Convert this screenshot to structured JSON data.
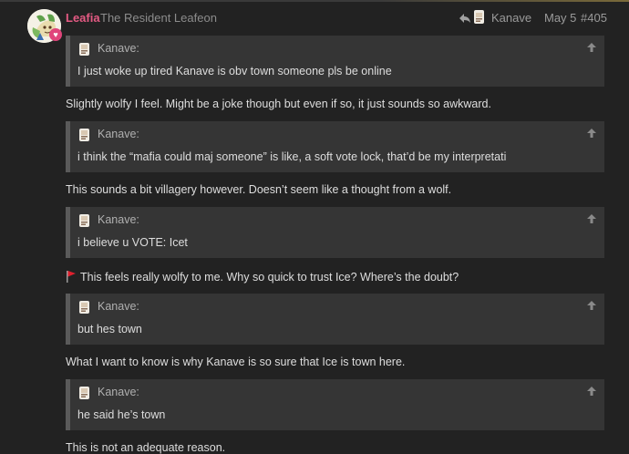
{
  "post": {
    "username": "Leafia",
    "user_title": "The Resident Leafeon",
    "reply_to": "Kanave",
    "date": "May 5",
    "post_number": "#405"
  },
  "blocks": [
    {
      "quote_author": "Kanave:",
      "quote_text": "I just woke up tired Kanave is obv town someone pls be online",
      "reply": "Slightly wolfy I feel. Might be a joke though but even if so, it just sounds so awkward."
    },
    {
      "quote_author": "Kanave:",
      "quote_text": "i think the “mafia could maj someone” is like, a soft vote lock, that’d be my interpretati",
      "reply": "This sounds a bit villagery however. Doesn’t seem like a thought from a wolf."
    },
    {
      "quote_author": "Kanave:",
      "quote_text": "i believe u VOTE: Icet",
      "reply": "This feels really wolfy to me. Why so quick to trust Ice? Where’s the doubt?"
    },
    {
      "quote_author": "Kanave:",
      "quote_text": "but hes town",
      "reply": "What I want to know is why Kanave is so sure that Ice is town here."
    },
    {
      "quote_author": "Kanave:",
      "quote_text": "he said he’s town",
      "reply": "This is not an adequate reason."
    }
  ],
  "icons": {
    "reply": "reply-arrow-icon",
    "expand": "arrow-up-icon",
    "flag": "red-flag-icon"
  },
  "colors": {
    "username": "#e45a83",
    "flag": "#e0202e",
    "quote_bg": "#353535",
    "page_bg": "#222222"
  }
}
